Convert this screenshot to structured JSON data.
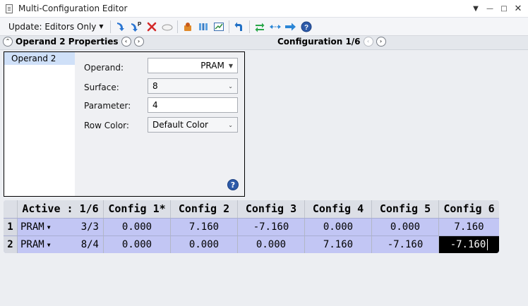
{
  "window": {
    "title": "Multi-Configuration Editor",
    "icons": {
      "app": "document-icon",
      "minimize": "chevron-down-icon",
      "restore": "minimize-icon",
      "maximize": "maximize-icon",
      "close": "close-icon"
    }
  },
  "toolbar": {
    "update_label": "Update: Editors Only",
    "icons": [
      "insert-operand-icon",
      "insert-after-icon",
      "delete-icon",
      "ellipse-icon",
      "solve-icon",
      "config-icon",
      "chart-icon",
      "undo-icon",
      "swap-icon",
      "expand-icon",
      "next-icon",
      "help-icon"
    ]
  },
  "panel_header": {
    "properties_label": "Operand 2 Properties",
    "configuration_label": "Configuration 1/6"
  },
  "properties": {
    "list_items": [
      "Operand 2"
    ],
    "operand_label": "Operand:",
    "operand_value": "PRAM",
    "surface_label": "Surface:",
    "surface_value": "8",
    "parameter_label": "Parameter:",
    "parameter_value": "4",
    "row_color_label": "Row Color:",
    "row_color_value": "Default Color"
  },
  "grid": {
    "headers": [
      "Active : 1/6",
      "Config 1*",
      "Config 2",
      "Config 3",
      "Config 4",
      "Config 5",
      "Config 6"
    ],
    "rows": [
      {
        "num": "1",
        "operand": "PRAM",
        "param": "3/3",
        "values": [
          "0.000",
          "7.160",
          "-7.160",
          "0.000",
          "0.000",
          "7.160"
        ]
      },
      {
        "num": "2",
        "operand": "PRAM",
        "param": "8/4",
        "values": [
          "0.000",
          "0.000",
          "0.000",
          "7.160",
          "-7.160",
          "-7.160"
        ]
      }
    ]
  },
  "colors": {
    "row_bg": "#c2c6f4",
    "selected_cell": "#000000",
    "help_blue": "#2d5aa8"
  }
}
